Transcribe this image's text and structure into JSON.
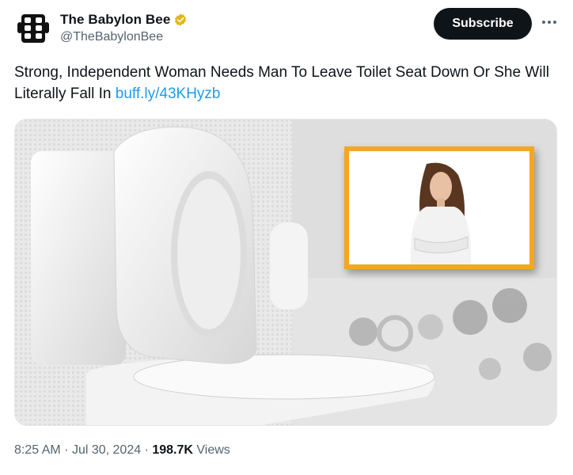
{
  "author": {
    "display_name": "The Babylon Bee",
    "handle": "@TheBabylonBee",
    "avatar_icon": "babylon-bee-logo-icon",
    "verified_icon": "verified-badge-icon",
    "verified_color": "#e2b719"
  },
  "actions": {
    "subscribe_label": "Subscribe",
    "more_icon": "more-options-icon"
  },
  "tweet": {
    "text": "Strong, Independent Woman Needs Man To Leave Toilet Seat Down Or She Will Literally Fall In ",
    "link_text": "buff.ly/43KHyzb",
    "link_color": "#1d9bf0"
  },
  "media": {
    "inset_frame_color": "#f5a623"
  },
  "meta": {
    "time": "8:25 AM",
    "separator": "·",
    "date": "Jul 30, 2024",
    "views_count": "198.7K",
    "views_label": "Views"
  }
}
